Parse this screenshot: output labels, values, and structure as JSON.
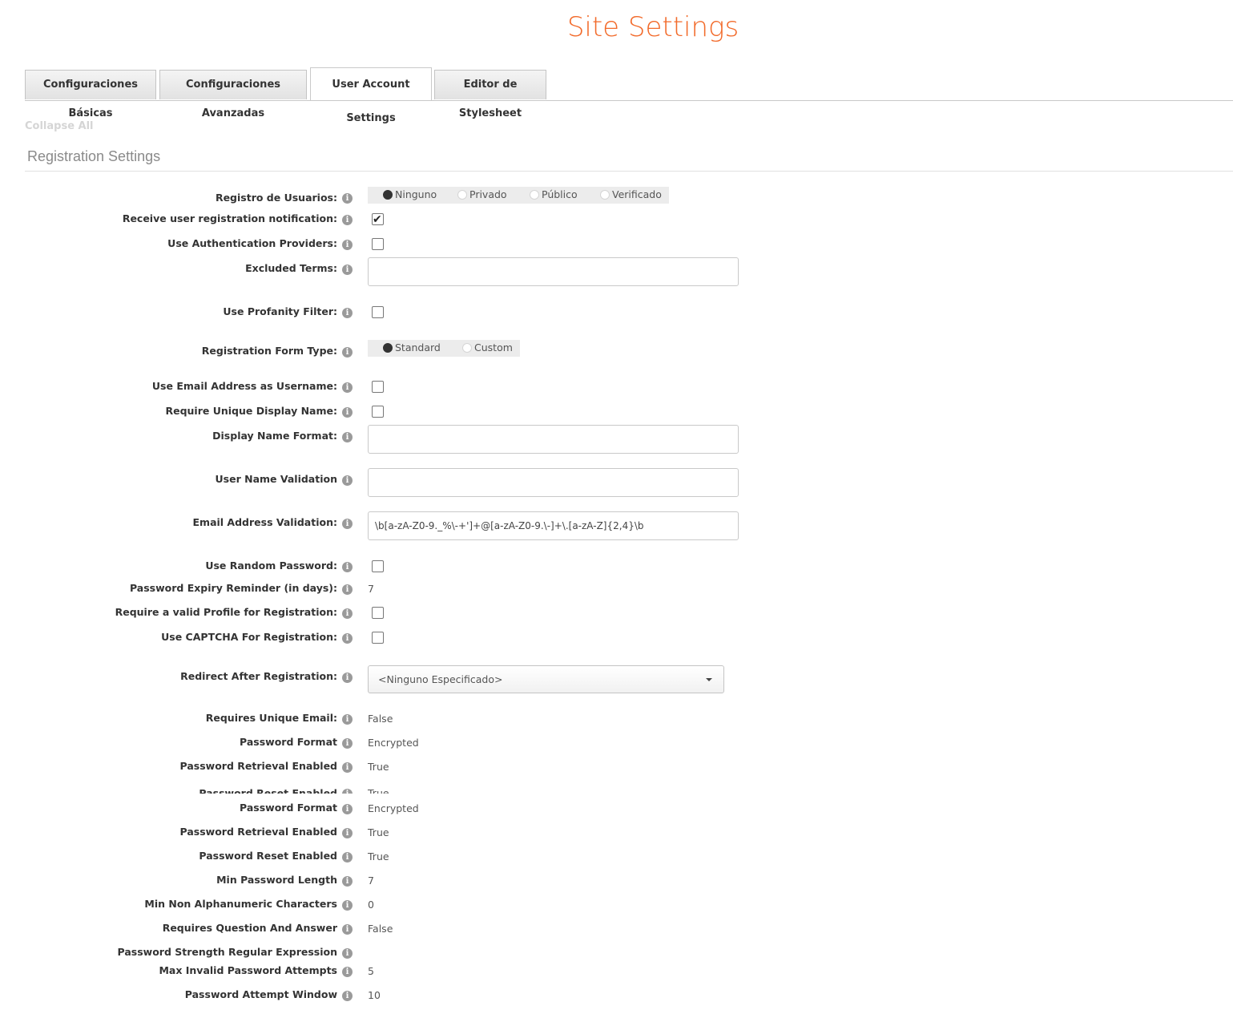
{
  "title": "Site Settings",
  "tabs": [
    {
      "label": "Configuraciones Básicas"
    },
    {
      "label": "Configuraciones Avanzadas"
    },
    {
      "label": "User Account Settings"
    },
    {
      "label": "Editor de Stylesheet"
    }
  ],
  "collapse_all": "Collapse All",
  "section": {
    "title": "Registration Settings"
  },
  "fields": {
    "user_registration": {
      "label": "Registro de Usuarios:",
      "options": [
        "Ninguno",
        "Privado",
        "Público",
        "Verificado"
      ],
      "selected": "Ninguno"
    },
    "receive_notification": {
      "label": "Receive user registration notification:",
      "checked": true
    },
    "use_auth_providers": {
      "label": "Use Authentication Providers:",
      "checked": false
    },
    "excluded_terms": {
      "label": "Excluded Terms:",
      "value": ""
    },
    "use_profanity_filter": {
      "label": "Use Profanity Filter:",
      "checked": false
    },
    "registration_form_type": {
      "label": "Registration Form Type:",
      "options": [
        "Standard",
        "Custom"
      ],
      "selected": "Standard"
    },
    "use_email_as_username": {
      "label": "Use Email Address as Username:",
      "checked": false
    },
    "require_unique_display_name": {
      "label": "Require Unique Display Name:",
      "checked": false
    },
    "display_name_format": {
      "label": "Display Name Format:",
      "value": ""
    },
    "user_name_validation": {
      "label": "User Name Validation",
      "value": ""
    },
    "email_address_validation": {
      "label": "Email Address Validation:",
      "value": "\\b[a-zA-Z0-9._%\\-+']+@[a-zA-Z0-9.\\-]+\\.[a-zA-Z]{2,4}\\b"
    },
    "use_random_password": {
      "label": "Use Random Password:",
      "checked": false
    },
    "password_expiry_reminder": {
      "label": "Password Expiry Reminder (in days):",
      "value": "7"
    },
    "require_valid_profile": {
      "label": "Require a valid Profile for Registration:",
      "checked": false
    },
    "use_captcha": {
      "label": "Use CAPTCHA For Registration:",
      "checked": false
    },
    "redirect_after_registration": {
      "label": "Redirect After Registration:",
      "selected": "<Ninguno Especificado>"
    },
    "requires_unique_email": {
      "label": "Requires Unique Email:",
      "value": "False"
    },
    "password_format_1": {
      "label": "Password Format",
      "value": "Encrypted"
    },
    "password_retrieval_1": {
      "label": "Password Retrieval Enabled",
      "value": "True"
    },
    "password_reset_cut": {
      "label": "Password Reset Enabled",
      "value": "True"
    },
    "password_format_2": {
      "label": "Password Format",
      "value": "Encrypted"
    },
    "password_retrieval_2": {
      "label": "Password Retrieval Enabled",
      "value": "True"
    },
    "password_reset_2": {
      "label": "Password Reset Enabled",
      "value": "True"
    },
    "min_password_length": {
      "label": "Min Password Length",
      "value": "7"
    },
    "min_non_alnum": {
      "label": "Min Non Alphanumeric Characters",
      "value": "0"
    },
    "requires_qa": {
      "label": "Requires Question And Answer",
      "value": "False"
    },
    "password_strength_regex": {
      "label": "Password Strength Regular Expression",
      "value": ""
    },
    "max_invalid_attempts": {
      "label": "Max Invalid Password Attempts",
      "value": "5"
    },
    "password_attempt_window": {
      "label": "Password Attempt Window",
      "value": "10"
    }
  },
  "icons": {
    "info": "info-icon",
    "check": "checkmark-icon",
    "dropdown": "caret-down-icon"
  },
  "colors": {
    "title": "#f26a2a",
    "tab_bg": "#e6e6e6",
    "radio_bg": "#ececec"
  }
}
